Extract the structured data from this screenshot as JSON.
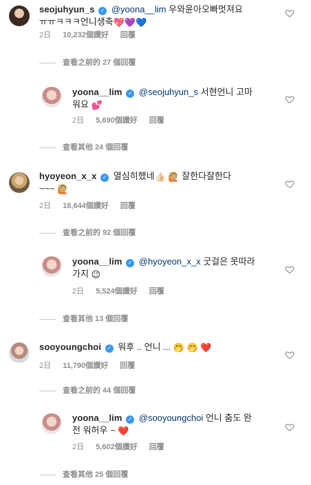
{
  "comments": [
    {
      "username": "seojuhyun_s",
      "text": "@yoona__lim 우와윤아오빠멋져요ㅠㅠㅋㅋㅋ언니생축",
      "mention": "@yoona__lim",
      "text_rest": "우와윤아오빠멋져요",
      "text_line2": "ㅠㅠㅋㅋㅋ언니생축",
      "emojis": "💖💜💙",
      "time": "2日",
      "likes": "10,232個讚好",
      "reply": "回覆",
      "view_replies": "查看之前的 27 個回覆"
    },
    {
      "username": "yoona__lim",
      "mention": "@seojuhyun_s",
      "text_rest": "서현언니 고마",
      "text_line2": "워요",
      "emojis": "💕",
      "time": "2日",
      "likes": "5,690個讚好",
      "reply": "回覆",
      "view_replies": "查看其他 24 個回覆"
    },
    {
      "username": "hyoyeon_x_x",
      "text_rest": "열심히했네",
      "emoji_a": "👍🏻",
      "emoji_b": "🙋🏼",
      "text_rest2": "잘한다잘한다",
      "text_line2": "~~~",
      "emoji_c": "🙋🏼",
      "time": "2日",
      "likes": "18,644個讚好",
      "reply": "回覆",
      "view_replies": "查看之前的 92 個回覆"
    },
    {
      "username": "yoona__lim",
      "mention": "@hyoyeon_x_x",
      "text_rest": "굿걸은 못따라",
      "text_line2": "가지",
      "emojis": "😉",
      "time": "2日",
      "likes": "5,524個讚好",
      "reply": "回覆",
      "view_replies": "查看其他 13 個回覆"
    },
    {
      "username": "sooyoungchoi",
      "text_rest": "워후 .. 언니 ...",
      "emojis": "🤭 🤭",
      "heart": "❤️",
      "time": "2日",
      "likes": "11,790個讚好",
      "reply": "回覆",
      "view_replies": "查看之前的 44 個回覆"
    },
    {
      "username": "yoona__lim",
      "mention": "@sooyoungchoi",
      "text_rest": "언니 춤도 완",
      "text_line2": "전 워허우 ~",
      "heart": "❤️",
      "time": "2日",
      "likes": "5,602個讚好",
      "reply": "回覆",
      "view_replies": "查看其他 25 個回覆"
    }
  ],
  "icons": {
    "verified": "verified-badge-icon",
    "heart": "heart-outline-icon"
  },
  "colors": {
    "mention": "#00376b",
    "meta": "#8e8e8e",
    "verified": "#3897f0"
  }
}
